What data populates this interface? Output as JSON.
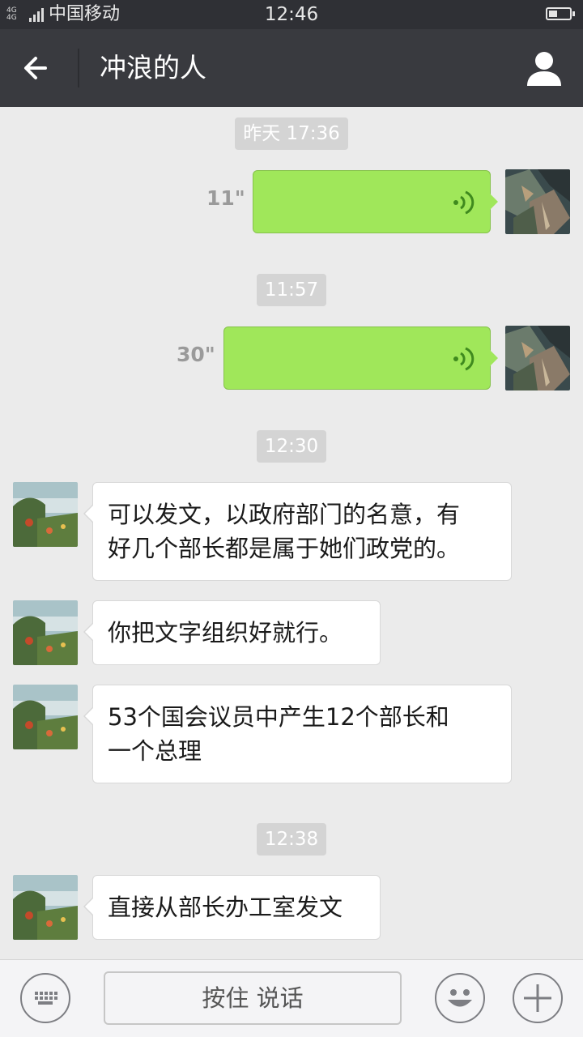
{
  "status_bar": {
    "network": "4G 4G",
    "carrier": "中国移动",
    "time": "12:46"
  },
  "header": {
    "title": "冲浪的人"
  },
  "messages": [
    {
      "type": "timestamp",
      "text": "昨天 17:36"
    },
    {
      "type": "voice",
      "side": "right",
      "duration": "11\""
    },
    {
      "type": "timestamp",
      "text": "11:57"
    },
    {
      "type": "voice",
      "side": "right",
      "duration": "30\""
    },
    {
      "type": "timestamp",
      "text": "12:30"
    },
    {
      "type": "text",
      "side": "left",
      "lines": [
        "可以发文，以政府部门的名意，有",
        "好几个部长都是属于她们政党的。"
      ]
    },
    {
      "type": "text",
      "side": "left",
      "lines": [
        "你把文字组织好就行。"
      ]
    },
    {
      "type": "text",
      "side": "left",
      "lines": [
        "53个国会议员中产生12个部长和",
        "一个总理"
      ]
    },
    {
      "type": "timestamp",
      "text": "12:38"
    },
    {
      "type": "text",
      "side": "left",
      "lines": [
        "直接从部长办工室发文"
      ]
    }
  ],
  "input_bar": {
    "hold_to_talk_label": "按住 说话",
    "left_icon": "keyboard-icon",
    "emoji_icon": "smiley-icon",
    "plus_icon": "plus-icon"
  },
  "colors": {
    "header_bg": "#393a3f",
    "chat_bg": "#ebebeb",
    "own_bubble": "#a0e75a",
    "other_bubble": "#ffffff",
    "timestamp_bg": "#d4d4d4"
  }
}
